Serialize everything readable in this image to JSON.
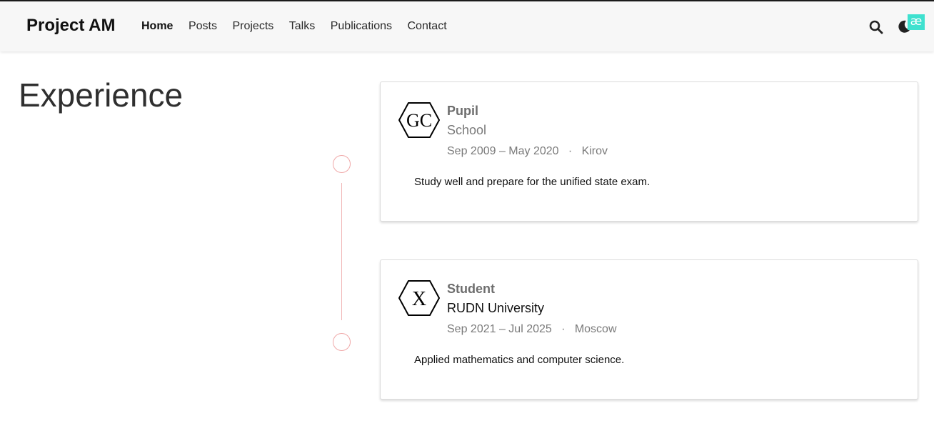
{
  "navbar": {
    "brand": "Project AM",
    "links": [
      {
        "label": "Home",
        "active": true
      },
      {
        "label": "Posts"
      },
      {
        "label": "Projects"
      },
      {
        "label": "Talks"
      },
      {
        "label": "Publications"
      },
      {
        "label": "Contact"
      }
    ],
    "icons": {
      "search": "search-icon",
      "theme": "moon-icon"
    },
    "badge": "æ"
  },
  "experience": {
    "title": "Experience",
    "items": [
      {
        "logo_text": "GC",
        "role": "Pupil",
        "organization": "School",
        "dates": "Sep 2009 – May 2020",
        "separator": "·",
        "location": "Kirov",
        "description": "Study well and prepare for the unified state exam."
      },
      {
        "logo_text": "X",
        "role": "Student",
        "organization": "RUDN University",
        "dates": "Sep 2021 – Jul 2025",
        "separator": "·",
        "location": "Moscow",
        "description": "Applied mathematics and computer science."
      }
    ]
  },
  "colors": {
    "timeline": "#f0a8a8",
    "badge": "#3fe1cf",
    "navbar_bg": "#f7f7f7"
  }
}
